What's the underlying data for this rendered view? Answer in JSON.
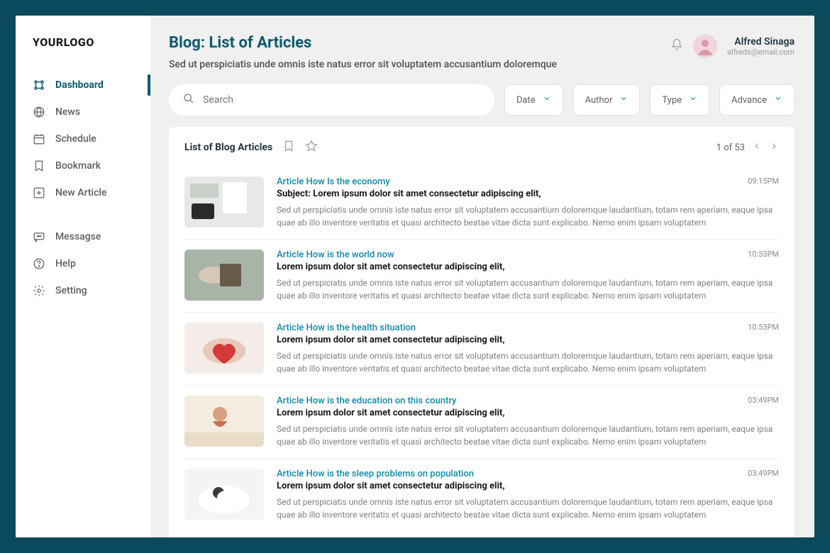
{
  "logo": "YOURLOGO",
  "sidebar": {
    "group1": [
      {
        "label": "Dashboard",
        "icon": "dashboard",
        "active": true
      },
      {
        "label": "News",
        "icon": "globe"
      },
      {
        "label": "Schedule",
        "icon": "calendar"
      },
      {
        "label": "Bookmark",
        "icon": "bookmark"
      },
      {
        "label": "New Article",
        "icon": "plus-box"
      }
    ],
    "group2": [
      {
        "label": "Messagse",
        "icon": "message"
      },
      {
        "label": "Help",
        "icon": "help"
      },
      {
        "label": "Setting",
        "icon": "settings"
      }
    ]
  },
  "header": {
    "title": "Blog: List of Articles",
    "subtitle": "Sed ut perspiciatis unde omnis iste natus error sit voluptatem accusantium doloremque",
    "user_name": "Alfred Sinaga",
    "user_email": "alfreds@email.com"
  },
  "search": {
    "placeholder": "Search"
  },
  "filters": {
    "date": "Date",
    "author": "Author",
    "type": "Type",
    "advance": "Advance"
  },
  "list": {
    "title": "List of Blog Articles",
    "pager": "1 of 53"
  },
  "articles": [
    {
      "category": "Article How Is the economy",
      "title": "Subject: Lorem ipsum dolor sit amet consectetur adipiscing elit,",
      "time": "09:15PM",
      "desc": "Sed ut perspiciatis unde omnis iste natus error sit voluptatem accusantium doloremque laudantium, totam rem aperiam, eaque ipsa quae ab illo inventore veritatis et quasi architecto beatae vitae dicta sunt explicabo. Nemo enim ipsam voluptatem"
    },
    {
      "category": "Article How is the world now",
      "title": " Lorem ipsum dolor sit amet consectetur adipiscing elit,",
      "time": "10:53PM",
      "desc": "Sed ut perspiciatis unde omnis iste natus error sit voluptatem accusantium doloremque laudantium, totam rem aperiam, eaque ipsa quae ab illo inventore veritatis et quasi architecto beatae vitae dicta sunt explicabo. Nemo enim ipsam voluptatem"
    },
    {
      "category": "Article How is the health situation",
      "title": "Lorem ipsum dolor sit amet consectetur adipiscing elit,",
      "time": "10:53PM",
      "desc": "Sed ut perspiciatis unde omnis iste natus error sit voluptatem accusantium doloremque laudantium, totam rem aperiam, eaque ipsa quae ab illo inventore veritatis et quasi architecto beatae vitae dicta sunt explicabo. Nemo enim ipsam voluptatem"
    },
    {
      "category": "Article How is the education on this country",
      "title": "Lorem ipsum dolor sit amet consectetur adipiscing elit,",
      "time": "03:49PM",
      "desc": "Sed ut perspiciatis unde omnis iste natus error sit voluptatem accusantium doloremque laudantium, totam rem aperiam, eaque ipsa quae ab illo inventore veritatis et quasi architecto beatae vitae dicta sunt explicabo. Nemo enim ipsam voluptatem"
    },
    {
      "category": "Article How is the sleep problems on population",
      "title": "Lorem ipsum dolor sit amet consectetur adipiscing elit,",
      "time": "03:49PM",
      "desc": "Sed ut perspiciatis unde omnis iste natus error sit voluptatem accusantium doloremque laudantium, totam rem aperiam, eaque ipsa quae ab illo inventore veritatis et quasi architecto beatae vitae dicta sunt explicabo. Nemo enim ipsam voluptatem"
    }
  ]
}
